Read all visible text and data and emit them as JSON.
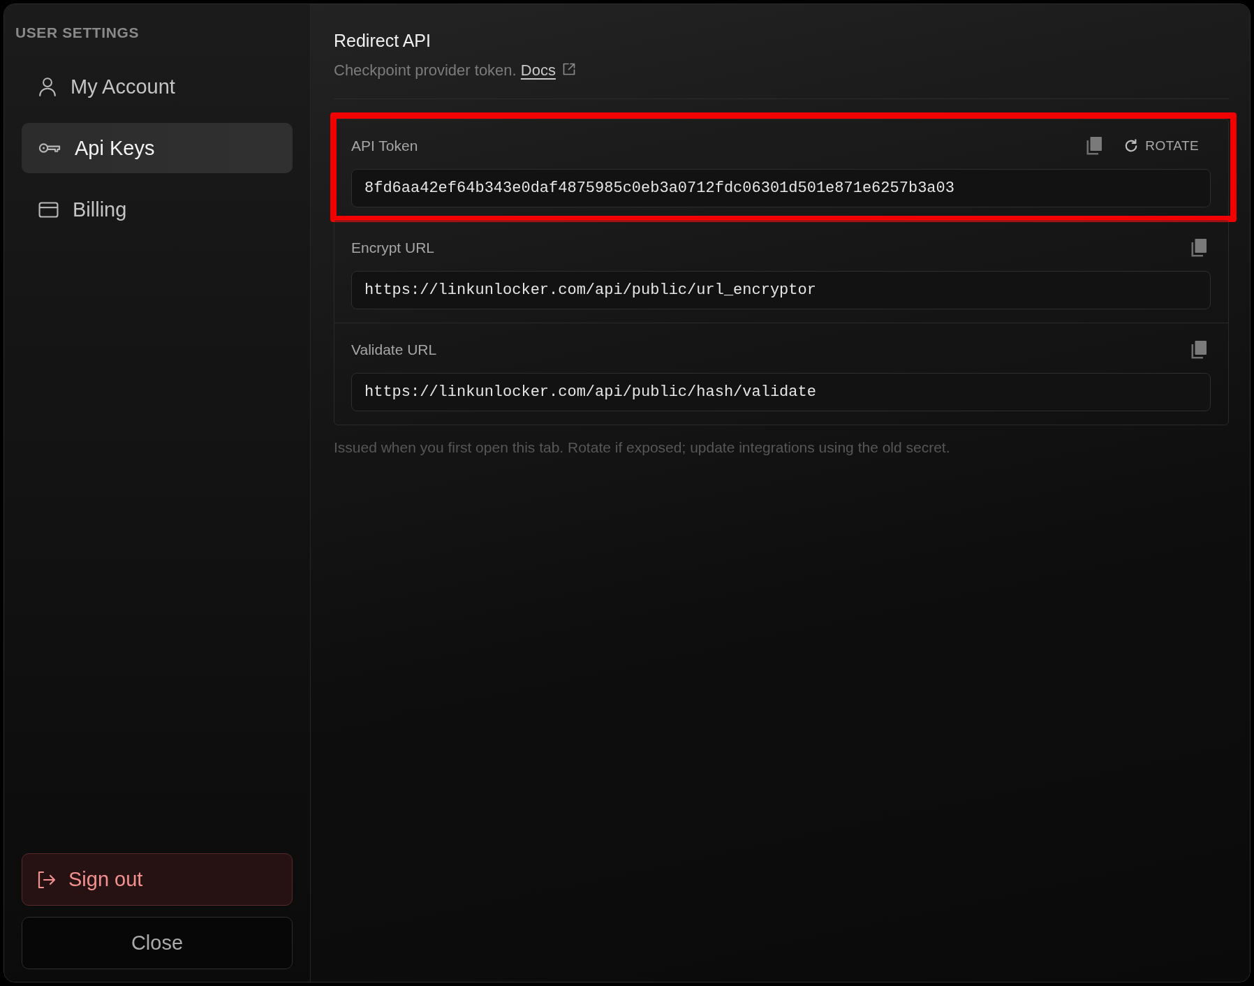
{
  "sidebar": {
    "heading": "USER SETTINGS",
    "items": [
      {
        "label": "My Account",
        "selected": false
      },
      {
        "label": "Api Keys",
        "selected": true
      },
      {
        "label": "Billing",
        "selected": false
      }
    ],
    "sign_out": {
      "label": "Sign out"
    },
    "close": {
      "label": "Close"
    }
  },
  "main": {
    "title": "Redirect API",
    "description": "Checkpoint provider token.",
    "docs_link": "Docs",
    "fields": [
      {
        "label": "API Token",
        "value": "8fd6aa42ef64b343e0daf4875985c0eb3a0712fdc06301d501e871e6257b3a03",
        "rotate_label": "ROTATE",
        "highlighted": true
      },
      {
        "label": "Encrypt URL",
        "value": "https://linkunlocker.com/api/public/url_encryptor",
        "highlighted": false
      },
      {
        "label": "Validate URL",
        "value": "https://linkunlocker.com/api/public/hash/validate",
        "highlighted": false
      }
    ],
    "note": "Issued when you first open this tab. Rotate if exposed; update integrations using the old secret."
  }
}
